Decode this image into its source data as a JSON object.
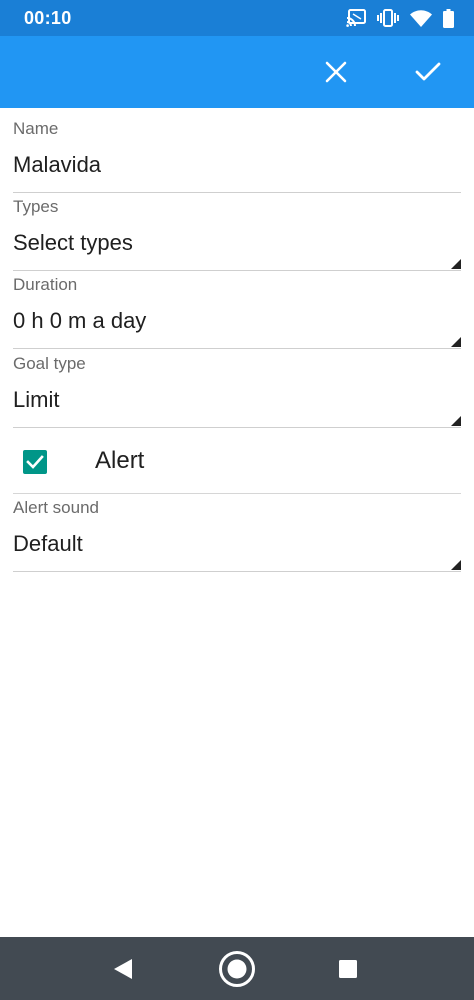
{
  "status_bar": {
    "time": "00:10",
    "icons": [
      "cast-icon",
      "vibrate-icon",
      "wifi-icon",
      "battery-icon"
    ]
  },
  "app_bar": {
    "color": "#2196f3",
    "actions": [
      "close-icon",
      "check-icon"
    ]
  },
  "form": {
    "name": {
      "label": "Name",
      "value": "Malavida"
    },
    "types": {
      "label": "Types",
      "value": "Select types"
    },
    "duration": {
      "label": "Duration",
      "value": "0 h 0 m a day"
    },
    "goal_type": {
      "label": "Goal type",
      "value": "Limit"
    },
    "alert": {
      "label": "Alert",
      "checked": true,
      "color": "#009688"
    },
    "alert_sound": {
      "label": "Alert sound",
      "value": "Default"
    }
  },
  "nav_bar": {
    "buttons": [
      "back-icon",
      "home-icon",
      "recents-icon"
    ]
  }
}
